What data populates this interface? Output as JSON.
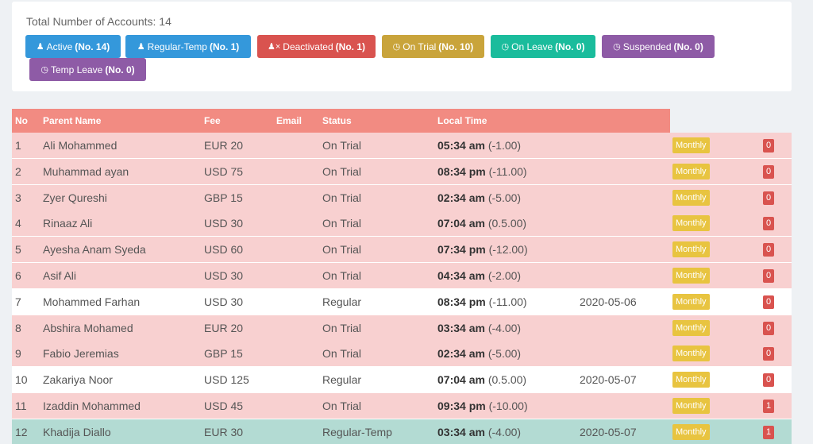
{
  "summary": {
    "total_label": "Total Number of Accounts: 14"
  },
  "filters": [
    {
      "label": "Active",
      "count": "(No. 14)",
      "icon": "user-icon",
      "color": "#3498db"
    },
    {
      "label": "Regular-Temp",
      "count": "(No. 1)",
      "icon": "user-icon",
      "color": "#3498db"
    },
    {
      "label": "Deactivated",
      "count": "(No. 1)",
      "icon": "user-times-icon",
      "color": "#d9534f"
    },
    {
      "label": "On Trial",
      "count": "(No. 10)",
      "icon": "clock-icon",
      "color": "#c9a43b"
    },
    {
      "label": "On Leave",
      "count": "(No. 0)",
      "icon": "clock-icon",
      "color": "#1abc9c"
    },
    {
      "label": "Suspended",
      "count": "(No. 0)",
      "icon": "clock-icon",
      "color": "#8e5ba6"
    },
    {
      "label": "Temp Leave",
      "count": "(No. 0)",
      "icon": "clock-icon",
      "color": "#8e5ba6"
    }
  ],
  "table": {
    "headers": {
      "no": "No",
      "name": "Parent Name",
      "fee": "Fee",
      "email": "Email",
      "status": "Status",
      "local_time": "Local Time"
    },
    "rows": [
      {
        "no": "1",
        "name": "Ali Mohammed",
        "fee": "EUR 20",
        "status": "On Trial",
        "time": "05:34 am",
        "offset": "(-1.00)",
        "date": "",
        "plan": "Monthly",
        "count": "0",
        "type": "trial"
      },
      {
        "no": "2",
        "name": "Muhammad ayan",
        "fee": "USD 75",
        "status": "On Trial",
        "time": "08:34 pm",
        "offset": "(-11.00)",
        "date": "",
        "plan": "Monthly",
        "count": "0",
        "type": "trial"
      },
      {
        "no": "3",
        "name": "Zyer Qureshi",
        "fee": "GBP 15",
        "status": "On Trial",
        "time": "02:34 am",
        "offset": "(-5.00)",
        "date": "",
        "plan": "Monthly",
        "count": "0",
        "type": "trial"
      },
      {
        "no": "4",
        "name": "Rinaaz Ali",
        "fee": "USD 30",
        "status": "On Trial",
        "time": "07:04 am",
        "offset": "(0.5.00)",
        "date": "",
        "plan": "Monthly",
        "count": "0",
        "type": "trial"
      },
      {
        "no": "5",
        "name": "Ayesha Anam Syeda",
        "fee": "USD 60",
        "status": "On Trial",
        "time": "07:34 pm",
        "offset": "(-12.00)",
        "date": "",
        "plan": "Monthly",
        "count": "0",
        "type": "trial"
      },
      {
        "no": "6",
        "name": "Asif Ali",
        "fee": "USD 30",
        "status": "On Trial",
        "time": "04:34 am",
        "offset": "(-2.00)",
        "date": "",
        "plan": "Monthly",
        "count": "0",
        "type": "trial"
      },
      {
        "no": "7",
        "name": "Mohammed Farhan",
        "fee": "USD 30",
        "status": "Regular",
        "time": "08:34 pm",
        "offset": "(-11.00)",
        "date": "2020-05-06",
        "plan": "Monthly",
        "count": "0",
        "type": "regular"
      },
      {
        "no": "8",
        "name": "Abshira Mohamed",
        "fee": "EUR 20",
        "status": "On Trial",
        "time": "03:34 am",
        "offset": "(-4.00)",
        "date": "",
        "plan": "Monthly",
        "count": "0",
        "type": "trial"
      },
      {
        "no": "9",
        "name": "Fabio Jeremias",
        "fee": "GBP 15",
        "status": "On Trial",
        "time": "02:34 am",
        "offset": "(-5.00)",
        "date": "",
        "plan": "Monthly",
        "count": "0",
        "type": "trial"
      },
      {
        "no": "10",
        "name": "Zakariya Noor",
        "fee": "USD 125",
        "status": "Regular",
        "time": "07:04 am",
        "offset": "(0.5.00)",
        "date": "2020-05-07",
        "plan": "Monthly",
        "count": "0",
        "type": "regular"
      },
      {
        "no": "11",
        "name": "Izaddin Mohammed",
        "fee": "USD 45",
        "status": "On Trial",
        "time": "09:34 pm",
        "offset": "(-10.00)",
        "date": "",
        "plan": "Monthly",
        "count": "1",
        "type": "trial"
      },
      {
        "no": "12",
        "name": "Khadija Diallo",
        "fee": "EUR 30",
        "status": "Regular-Temp",
        "time": "03:34 am",
        "offset": "(-4.00)",
        "date": "2020-05-07",
        "plan": "Monthly",
        "count": "1",
        "type": "rtemp"
      }
    ]
  }
}
